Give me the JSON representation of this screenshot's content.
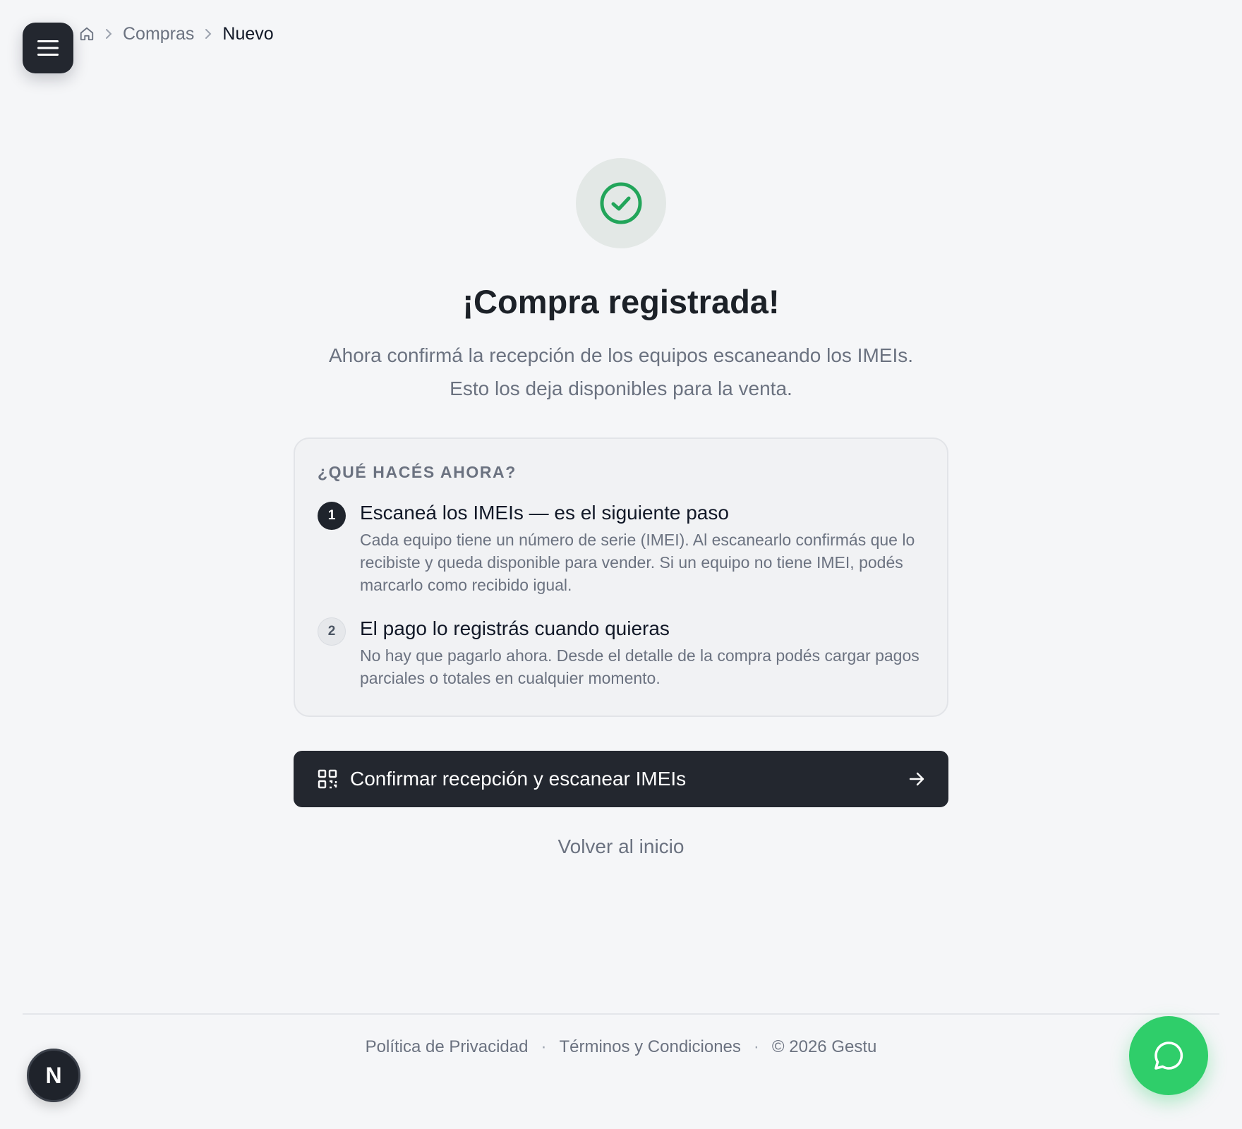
{
  "header": {
    "menu_icon": "hamburger-menu-icon",
    "breadcrumb": {
      "home_icon": "home-icon",
      "items": [
        "Compras",
        "Nuevo"
      ]
    }
  },
  "main": {
    "status_icon": "check-circle-icon",
    "title": "¡Compra registrada!",
    "subtitle_line1": "Ahora confirmá la recepción de los equipos escaneando los IMEIs.",
    "subtitle_line2": "Esto los deja disponibles para la venta.",
    "card": {
      "heading": "¿QUÉ HACÉS AHORA?",
      "steps": [
        {
          "number": "1",
          "title": "Escaneá los IMEIs — es el siguiente paso",
          "description": "Cada equipo tiene un número de serie (IMEI). Al escanearlo confirmás que lo recibiste y queda disponible para vender. Si un equipo no tiene IMEI, podés marcarlo como recibido igual."
        },
        {
          "number": "2",
          "title": "El pago lo registrás cuando quieras",
          "description": "No hay que pagarlo ahora. Desde el detalle de la compra podés cargar pagos parciales o totales en cualquier momento."
        }
      ]
    },
    "primary_button": {
      "icon": "qr-code-icon",
      "label": "Confirmar recepción y escanear IMEIs",
      "trailing_icon": "arrow-right-icon"
    },
    "secondary_link": "Volver al inicio"
  },
  "footer": {
    "privacy": "Política de Privacidad",
    "separator": "·",
    "terms": "Términos y Condiciones",
    "copyright": "© 2026 Gestu"
  },
  "avatar": {
    "initial": "N"
  },
  "chat": {
    "icon": "chat-bubble-icon"
  },
  "colors": {
    "accent_dark": "#23272f",
    "success": "#22a55a",
    "chat_green": "#2fce6a",
    "background": "#f5f6f8"
  }
}
